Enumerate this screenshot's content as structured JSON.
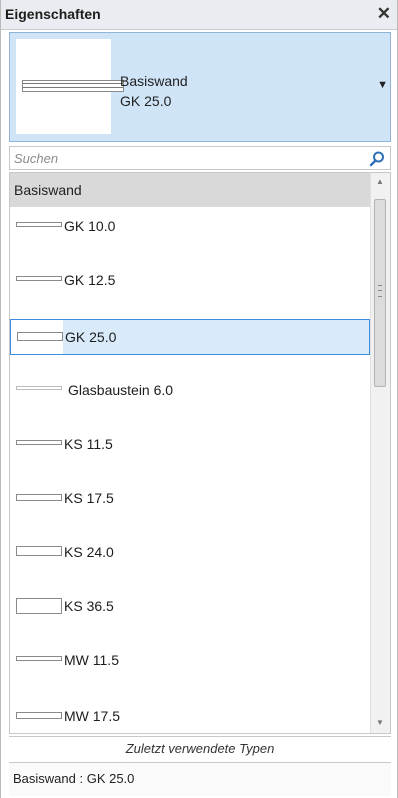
{
  "window": {
    "title": "Eigenschaften",
    "close_glyph": "✕"
  },
  "type_selector": {
    "family": "Basiswand",
    "type": "GK 25.0",
    "dropdown_glyph": "▼"
  },
  "search": {
    "placeholder": "Suchen",
    "icon": "search-icon"
  },
  "list": {
    "group_label": "Basiswand",
    "items": [
      {
        "label": "GK 10.0",
        "selected": false
      },
      {
        "label": "GK 12.5",
        "selected": false
      },
      {
        "label": "GK 25.0",
        "selected": true
      },
      {
        "label": "Glasbaustein 6.0",
        "selected": false
      },
      {
        "label": "KS 11.5",
        "selected": false
      },
      {
        "label": "KS 17.5",
        "selected": false
      },
      {
        "label": "KS 24.0",
        "selected": false
      },
      {
        "label": "KS 36.5",
        "selected": false
      },
      {
        "label": "MW 11.5",
        "selected": false
      },
      {
        "label": "MW 17.5",
        "selected": false
      }
    ]
  },
  "footer": {
    "recent_label": "Zuletzt verwendete Typen",
    "status": "Basiswand : GK 25.0"
  },
  "colors": {
    "selection_fill": "#d9ebfb",
    "selection_border": "#3d8ee0",
    "selector_fill": "#cfe4f7"
  }
}
